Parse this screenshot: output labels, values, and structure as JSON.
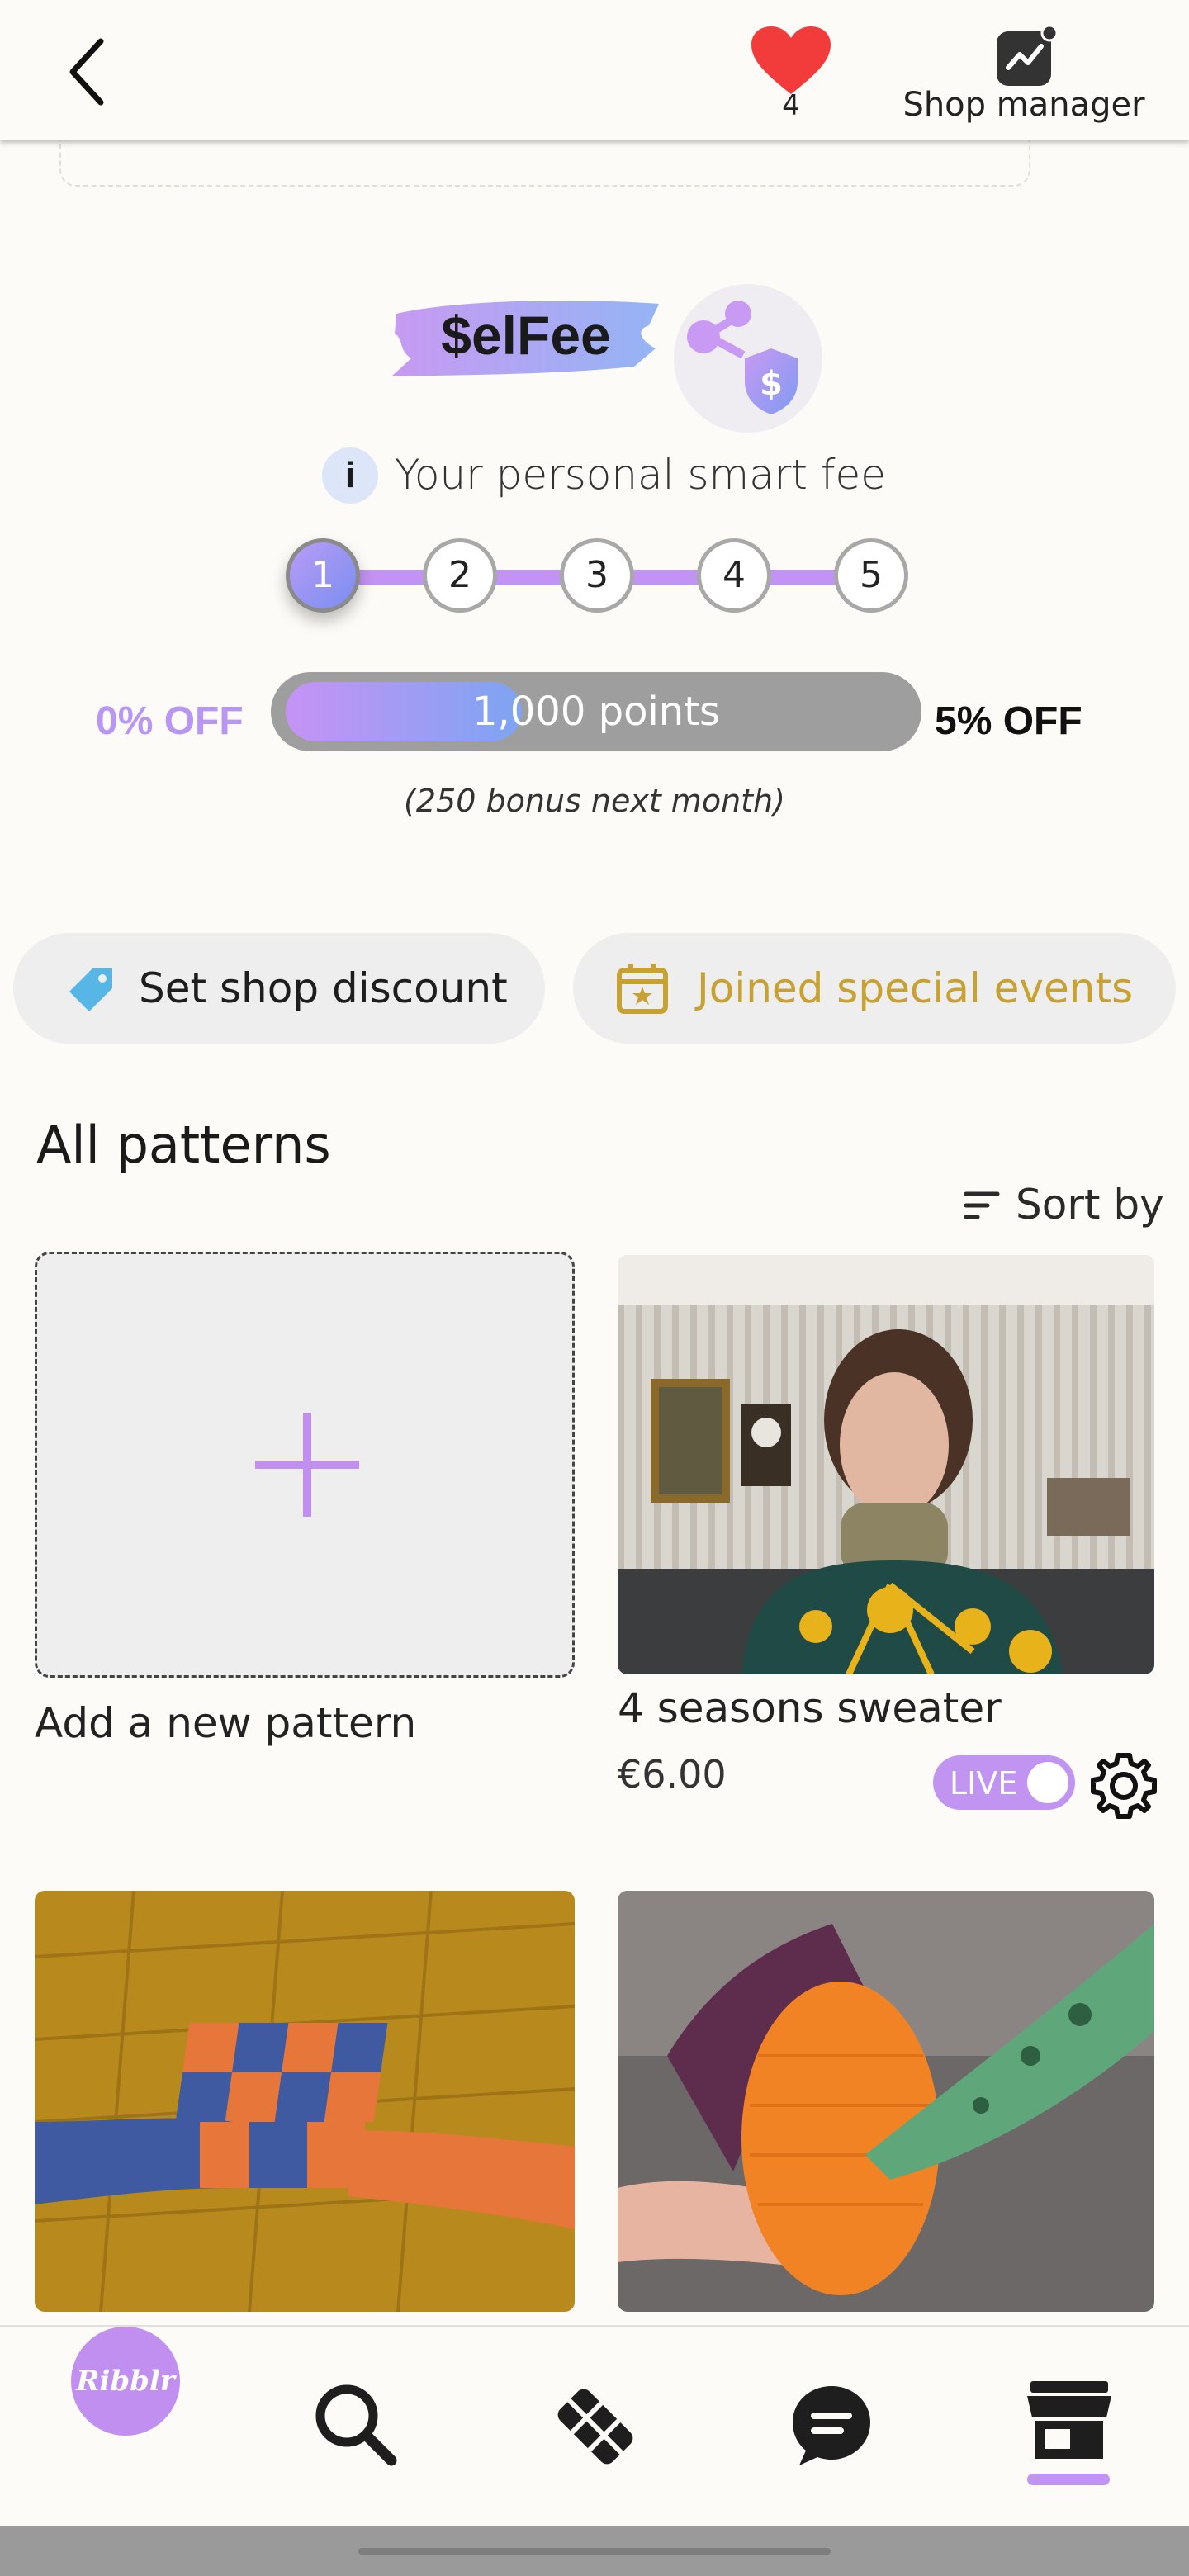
{
  "header": {
    "favorites_count": "4",
    "shop_manager_label": "Shop manager"
  },
  "selfee": {
    "brand": "$elFee",
    "info_text": "Your personal smart fee",
    "info_icon_glyph": "i",
    "steps": [
      "1",
      "2",
      "3",
      "4",
      "5"
    ],
    "active_step": 1,
    "left_off": "0% OFF",
    "right_off": "5% OFF",
    "points_label": "1,000 points",
    "points_progress": 0.38,
    "bonus_text": "(250 bonus next month)"
  },
  "actions": {
    "discount_label": "Set shop discount",
    "events_label": "Joined special events"
  },
  "patterns": {
    "title": "All patterns",
    "sort_label": "Sort by",
    "add_label": "Add a new pattern",
    "items": [
      {
        "title": "4 seasons sweater",
        "price": "€6.00",
        "status": "LIVE"
      }
    ]
  },
  "nav": {
    "logo_text": "Ribblr",
    "items": [
      "ribblr-logo",
      "search-icon",
      "patterns-icon",
      "chat-icon",
      "shop-icon"
    ],
    "active": "shop-icon"
  },
  "colors": {
    "accent": "#c194f2",
    "gold": "#c7a233",
    "heart": "#f23b3b"
  }
}
